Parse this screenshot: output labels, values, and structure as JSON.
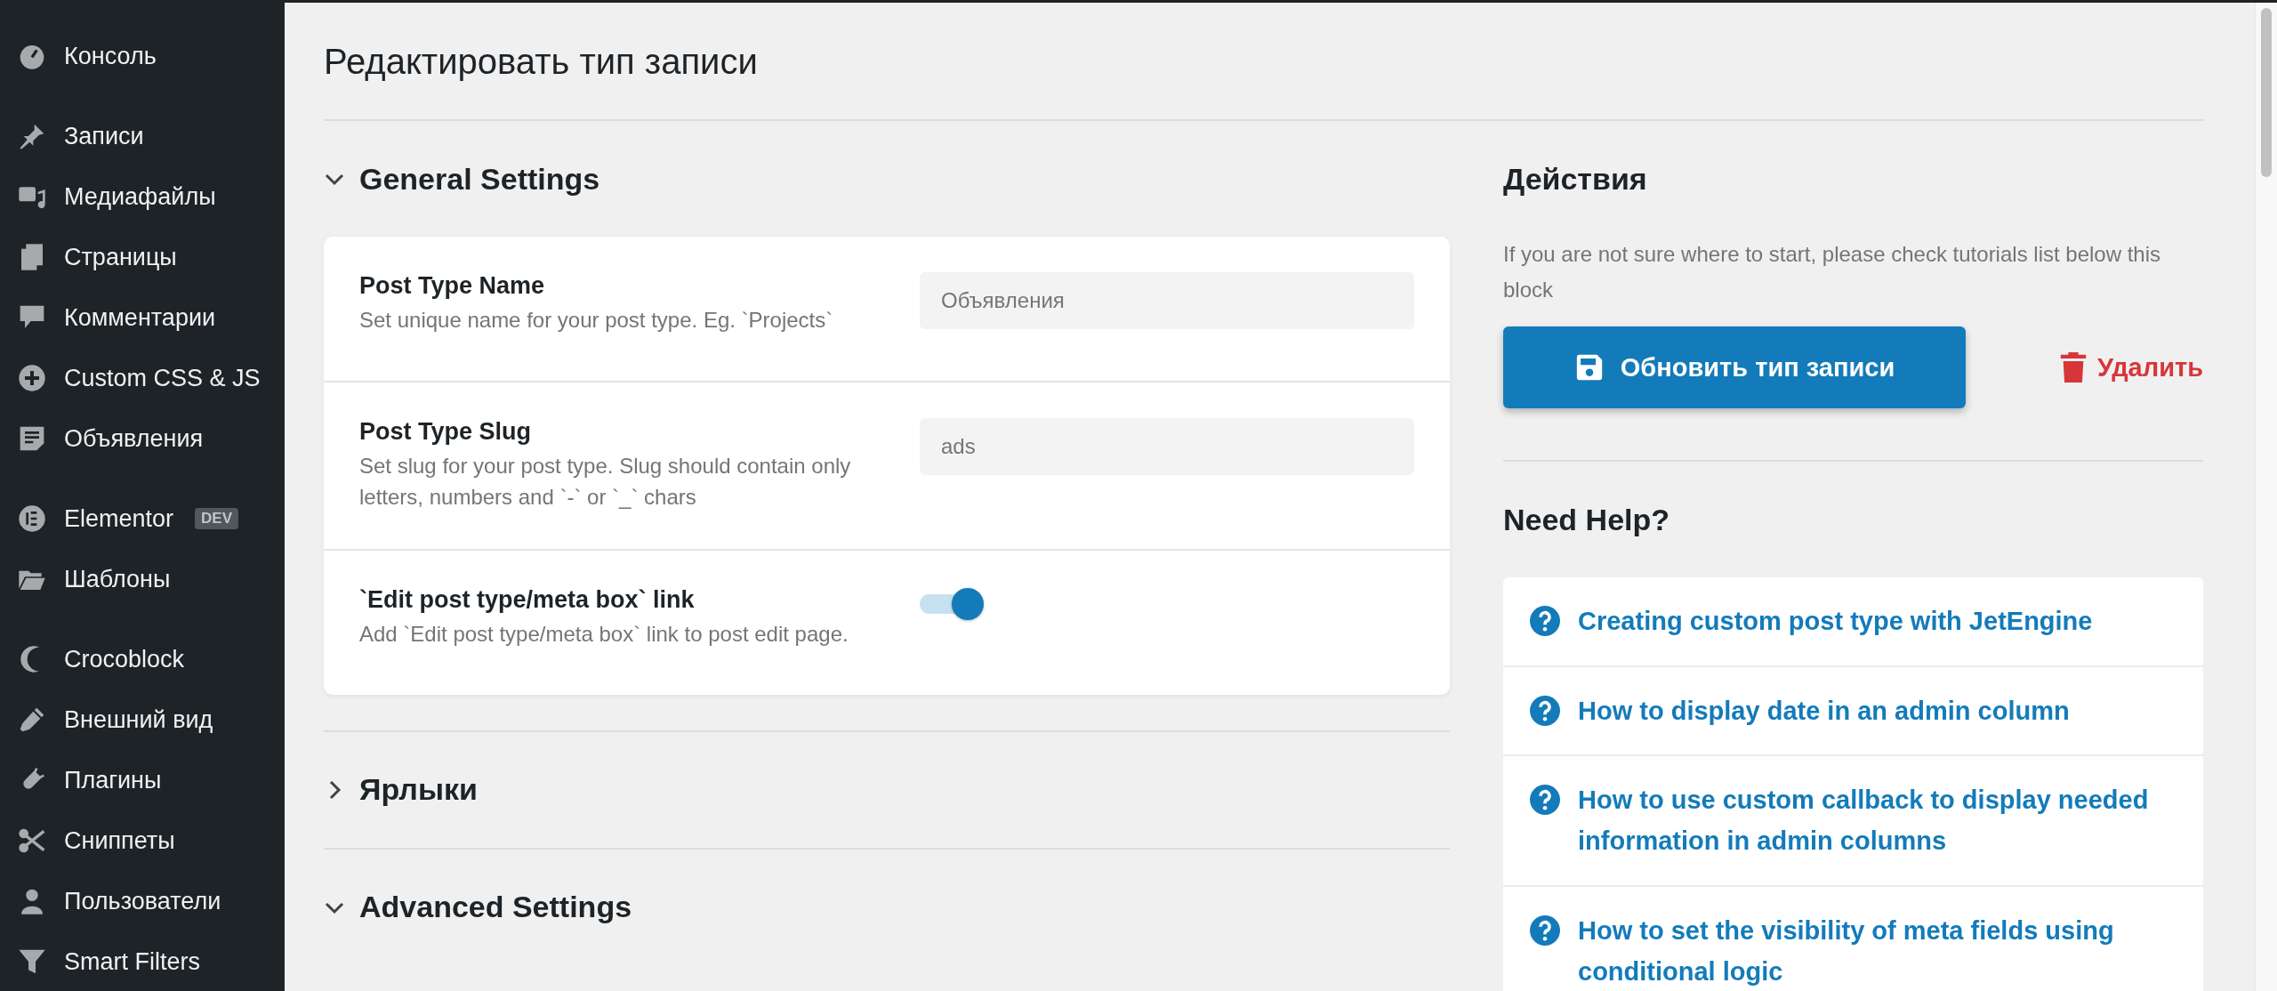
{
  "sidebar": {
    "groups": [
      {
        "items": [
          {
            "label": "Консоль"
          }
        ]
      },
      {
        "items": [
          {
            "label": "Записи"
          },
          {
            "label": "Медиафайлы"
          },
          {
            "label": "Страницы"
          },
          {
            "label": "Комментарии"
          },
          {
            "label": "Custom CSS & JS"
          },
          {
            "label": "Объявления"
          }
        ]
      },
      {
        "items": [
          {
            "label": "Elementor",
            "badge": "DEV"
          },
          {
            "label": "Шаблоны"
          }
        ]
      },
      {
        "items": [
          {
            "label": "Crocoblock"
          },
          {
            "label": "Внешний вид"
          },
          {
            "label": "Плагины"
          },
          {
            "label": "Сниппеты"
          },
          {
            "label": "Пользователи"
          },
          {
            "label": "Smart Filters"
          }
        ]
      }
    ]
  },
  "page_title": "Редактировать тип записи",
  "sections": [
    {
      "title": "General Settings",
      "expanded": true,
      "fields": [
        {
          "kind": "text",
          "label": "Post Type Name",
          "description": "Set unique name for your post type. Eg. `Projects`",
          "value": "Объявления"
        },
        {
          "kind": "text",
          "label": "Post Type Slug",
          "description": "Set slug for your post type. Slug should contain only letters, numbers and `-` or `_` chars",
          "value": "ads"
        },
        {
          "kind": "toggle",
          "label": "`Edit post type/meta box` link",
          "description": "Add `Edit post type/meta box` link to post edit page.",
          "checked": true
        }
      ]
    },
    {
      "title": "Ярлыки",
      "expanded": false
    },
    {
      "title": "Advanced Settings",
      "expanded": true
    }
  ],
  "actions": {
    "title": "Действия",
    "hint": "If you are not sure where to start, please check tutorials list below this block",
    "update_button": "Обновить тип записи",
    "delete_button": "Удалить"
  },
  "help": {
    "title": "Need Help?",
    "links": [
      "Creating custom post type with JetEngine",
      "How to display date in an admin column",
      "How to use custom callback to display needed information in admin columns",
      "How to set the visibility of meta fields using conditional logic"
    ]
  }
}
